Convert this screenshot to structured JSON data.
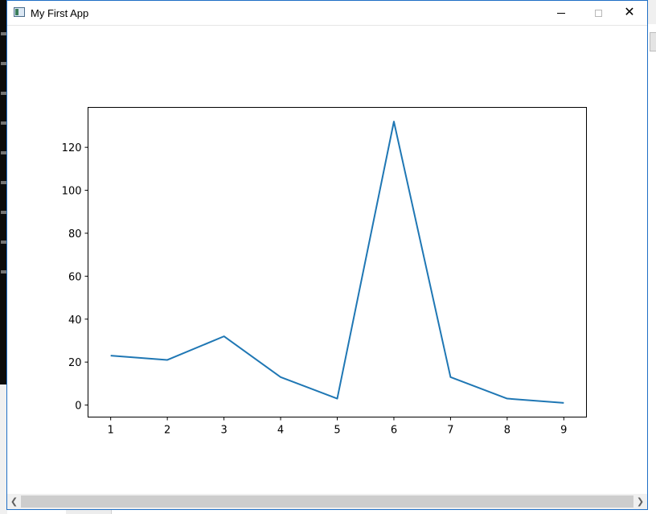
{
  "window": {
    "title": "My First App"
  },
  "colors": {
    "line": "#1f77b4",
    "frame": "#1f6fc6"
  },
  "icons": {
    "app": "app-window-icon",
    "minimize": "minimize-icon",
    "maximize": "maximize-icon",
    "close": "close-icon",
    "scroll_left": "chevron-left-icon",
    "scroll_right": "chevron-right-icon"
  },
  "chart_data": {
    "type": "line",
    "title": "",
    "xlabel": "",
    "ylabel": "",
    "x": [
      1,
      2,
      3,
      4,
      5,
      6,
      7,
      8,
      9
    ],
    "series": [
      {
        "values": [
          23,
          21,
          32,
          13,
          3,
          132,
          13,
          3,
          1
        ]
      }
    ],
    "xlim": [
      0.6,
      9.4
    ],
    "ylim": [
      -5.6,
      138.6
    ],
    "xticks": [
      1,
      2,
      3,
      4,
      5,
      6,
      7,
      8,
      9
    ],
    "yticks": [
      0,
      20,
      40,
      60,
      80,
      100,
      120
    ],
    "grid": false,
    "legend": "none"
  }
}
